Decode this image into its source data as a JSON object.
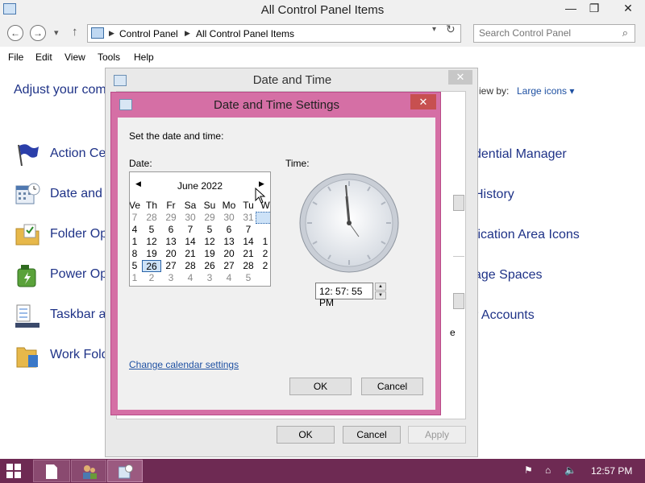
{
  "window": {
    "title": "All Control Panel Items",
    "controls": {
      "minimize": "—",
      "maximize": "❐",
      "close": "✕"
    }
  },
  "address": {
    "crumbs": [
      "Control Panel",
      "All Control Panel Items"
    ],
    "search_placeholder": "Search Control Panel"
  },
  "menu": [
    "File",
    "Edit",
    "View",
    "Tools",
    "Help"
  ],
  "main": {
    "heading": "Adjust your com",
    "view_by_label": "iew by:",
    "view_by_value": "Large icons ▾",
    "left_items": [
      "Action Cen",
      "Date and T",
      "Folder Op",
      "Power Op",
      "Taskbar a",
      "Work Fold"
    ],
    "right_items": [
      "dential Manager",
      "History",
      "fication Area Icons",
      "age Spaces",
      "r Accounts"
    ]
  },
  "bg_dialog": {
    "title": "Date and Time",
    "close": "✕",
    "fragment": "e",
    "buttons": {
      "ok": "OK",
      "cancel": "Cancel",
      "apply": "Apply"
    }
  },
  "settings_dialog": {
    "title": "Date and Time Settings",
    "close": "✕",
    "instruction": "Set the date and time:",
    "date_label": "Date:",
    "time_label": "Time:",
    "calendar": {
      "month": "June 2022",
      "prev": "◀",
      "next": "▶",
      "days_of_week": [
        "Ve",
        "Th",
        "Fr",
        "Sa",
        "Su",
        "Mo",
        "Tu",
        "W"
      ],
      "weeks": [
        [
          "7",
          "28",
          "29",
          "30",
          "29",
          "30",
          "31",
          ""
        ],
        [
          "4",
          "5",
          "6",
          "7",
          "5",
          "6",
          "7",
          ""
        ],
        [
          "1",
          "12",
          "13",
          "14",
          "12",
          "13",
          "14",
          "1"
        ],
        [
          "8",
          "19",
          "20",
          "21",
          "19",
          "20",
          "21",
          "2"
        ],
        [
          "5",
          "26",
          "27",
          "28",
          "26",
          "27",
          "28",
          "2"
        ],
        [
          "1",
          "2",
          "3",
          "4",
          "3",
          "4",
          "5",
          ""
        ]
      ],
      "selected_day": "26"
    },
    "time_value": "12: 57: 55 PM",
    "spin_up": "▲",
    "spin_down": "▼",
    "calendar_link": "Change calendar settings",
    "buttons": {
      "ok": "OK",
      "cancel": "Cancel"
    }
  },
  "taskbar": {
    "time": "12:57 PM",
    "accent": "#6e2a53"
  }
}
